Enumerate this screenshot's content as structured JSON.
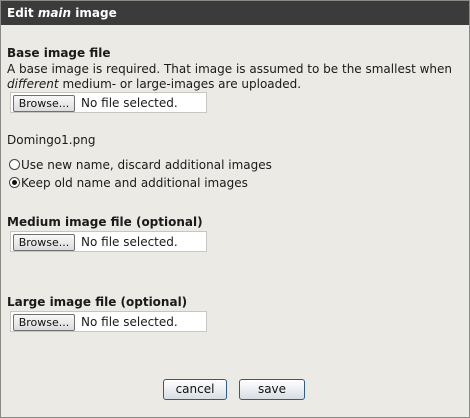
{
  "dialog": {
    "title_prefix": "Edit ",
    "title_emph": "main",
    "title_suffix": " image"
  },
  "base": {
    "title": "Base image file",
    "desc_1": "A base image is required. That image is assumed to be the smallest when ",
    "desc_emph": "different",
    "desc_2": " medium- or large-images are uploaded.",
    "browse_label": "Browse...",
    "file_status": "No file selected.",
    "current_file": "Domingo1.png"
  },
  "options": [
    {
      "label": "Use new name, discard additional images",
      "selected": false
    },
    {
      "label": "Keep old name and additional images",
      "selected": true
    }
  ],
  "medium": {
    "title": "Medium image file (optional)",
    "browse_label": "Browse...",
    "file_status": "No file selected."
  },
  "large": {
    "title": "Large image file (optional)",
    "browse_label": "Browse...",
    "file_status": "No file selected."
  },
  "actions": {
    "cancel_label": "cancel",
    "save_label": "save"
  }
}
